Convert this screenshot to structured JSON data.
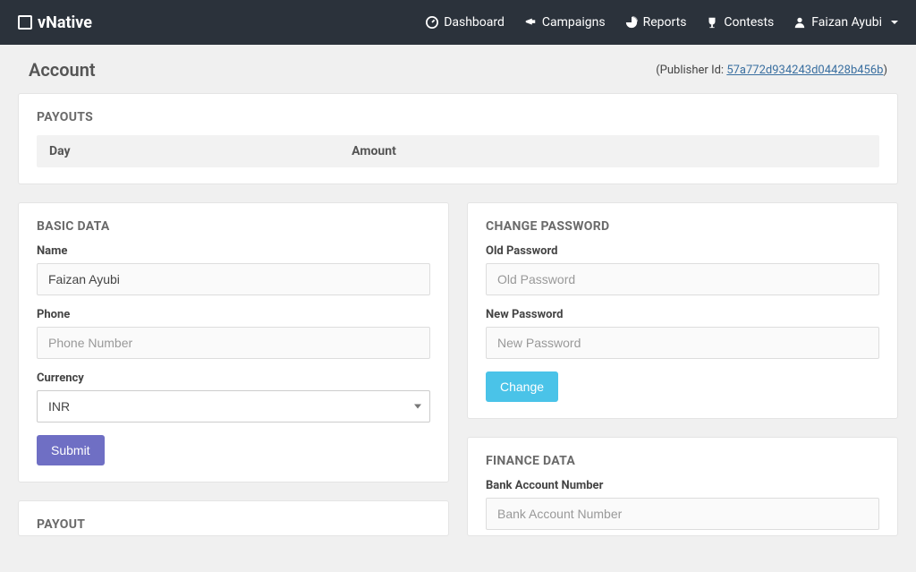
{
  "brand": "vNative",
  "nav": {
    "dashboard": "Dashboard",
    "campaigns": "Campaigns",
    "reports": "Reports",
    "contests": "Contests",
    "user": "Faizan Ayubi"
  },
  "header": {
    "title": "Account",
    "publisher_label": "(Publisher Id: ",
    "publisher_id": "57a772d934243d04428b456b",
    "publisher_close": ")"
  },
  "payouts": {
    "title": "PAYOUTS",
    "col_day": "Day",
    "col_amount": "Amount"
  },
  "basic": {
    "title": "BASIC DATA",
    "name_label": "Name",
    "name_value": "Faizan Ayubi",
    "phone_label": "Phone",
    "phone_placeholder": "Phone Number",
    "currency_label": "Currency",
    "currency_value": "INR",
    "submit": "Submit"
  },
  "payout": {
    "title": "PAYOUT"
  },
  "password": {
    "title": "CHANGE PASSWORD",
    "old_label": "Old Password",
    "old_placeholder": "Old Password",
    "new_label": "New Password",
    "new_placeholder": "New Password",
    "change": "Change"
  },
  "finance": {
    "title": "FINANCE DATA",
    "bank_label": "Bank Account Number",
    "bank_placeholder": "Bank Account Number"
  }
}
